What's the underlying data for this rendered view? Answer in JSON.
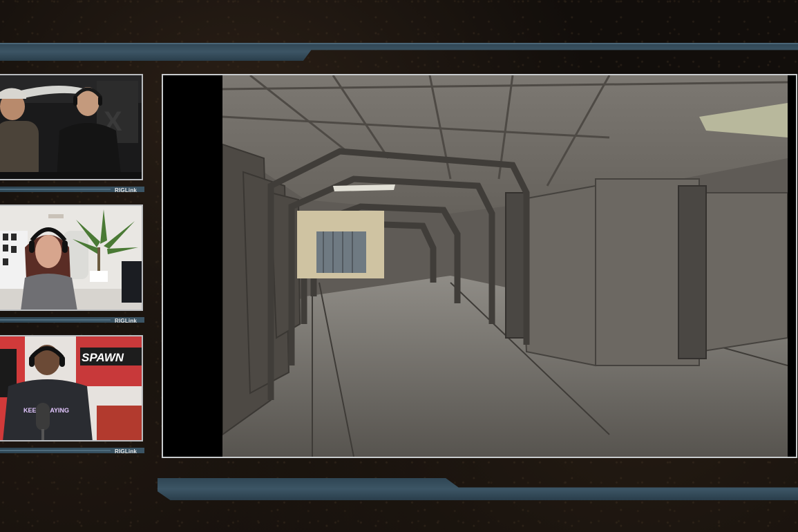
{
  "webcams": [
    {
      "label": "RIGLink"
    },
    {
      "label": "RIGLink"
    },
    {
      "label": "RIGLink",
      "sign_text": "SPAWN",
      "shirt_text": "KEEP PLAYING"
    }
  ],
  "colors": {
    "accent_bar": "#3c5565",
    "frame_border": "#c9ccce",
    "background": "#120e0b"
  }
}
